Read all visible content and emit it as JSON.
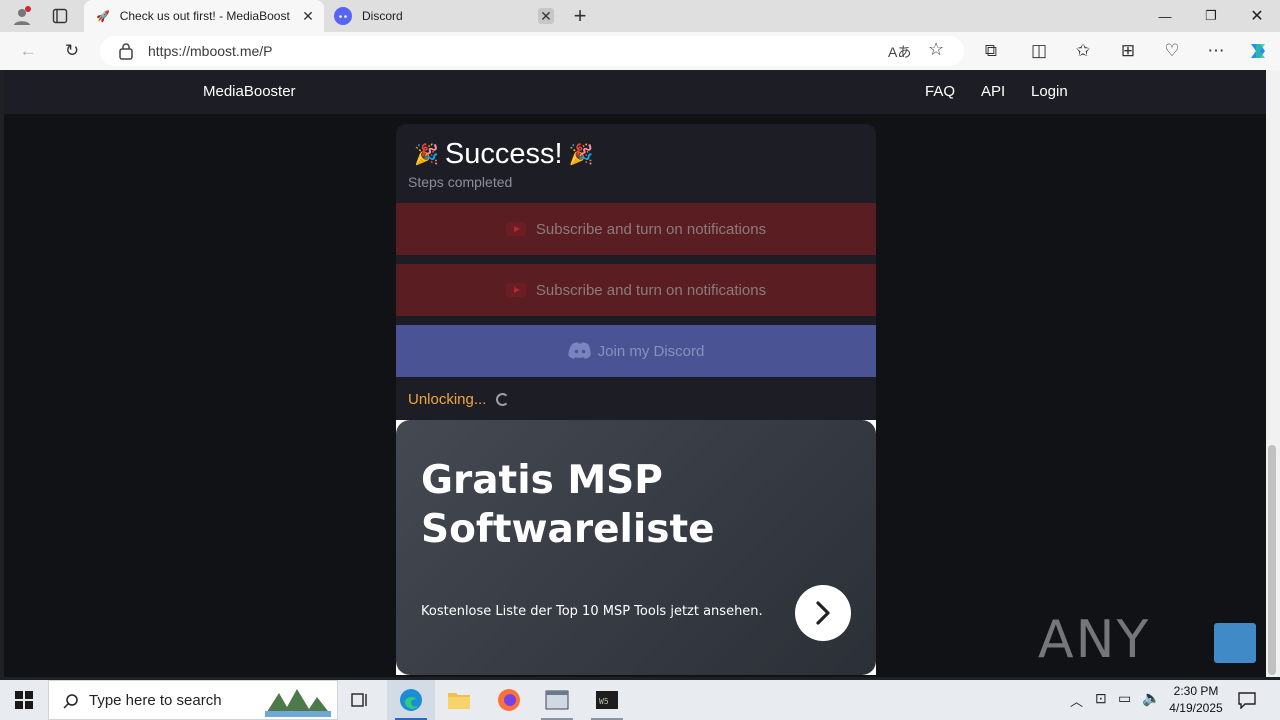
{
  "browser": {
    "tabs": [
      {
        "title": "Check us out first! - MediaBooster",
        "active": true
      },
      {
        "title": "Discord",
        "active": false
      }
    ],
    "url": "https://mboost.me/P"
  },
  "site": {
    "brand": "MediaBooster",
    "nav": [
      "FAQ",
      "API",
      "Login"
    ]
  },
  "card": {
    "heading": "Success!",
    "subheading": "Steps completed",
    "steps": [
      {
        "label": "Subscribe and turn on notifications",
        "icon": "youtube-icon"
      },
      {
        "label": "Subscribe and turn on notifications",
        "icon": "youtube-icon"
      },
      {
        "label": "Join my Discord",
        "icon": "discord-icon"
      }
    ],
    "status": "Unlocking..."
  },
  "ad": {
    "headline": "Gratis MSP Softwareliste",
    "description": "Kostenlose Liste der Top 10 MSP Tools jetzt ansehen."
  },
  "watermark": "ANY RUN",
  "taskbar": {
    "search_placeholder": "Type here to search",
    "time": "2:30 PM",
    "date": "4/19/2025"
  },
  "colors": {
    "page_bg": "#111216",
    "card_bg": "#1d1e25",
    "youtube_step": "#5a1d22",
    "discord_step": "#4a5494",
    "status_orange": "#f0a73a"
  }
}
